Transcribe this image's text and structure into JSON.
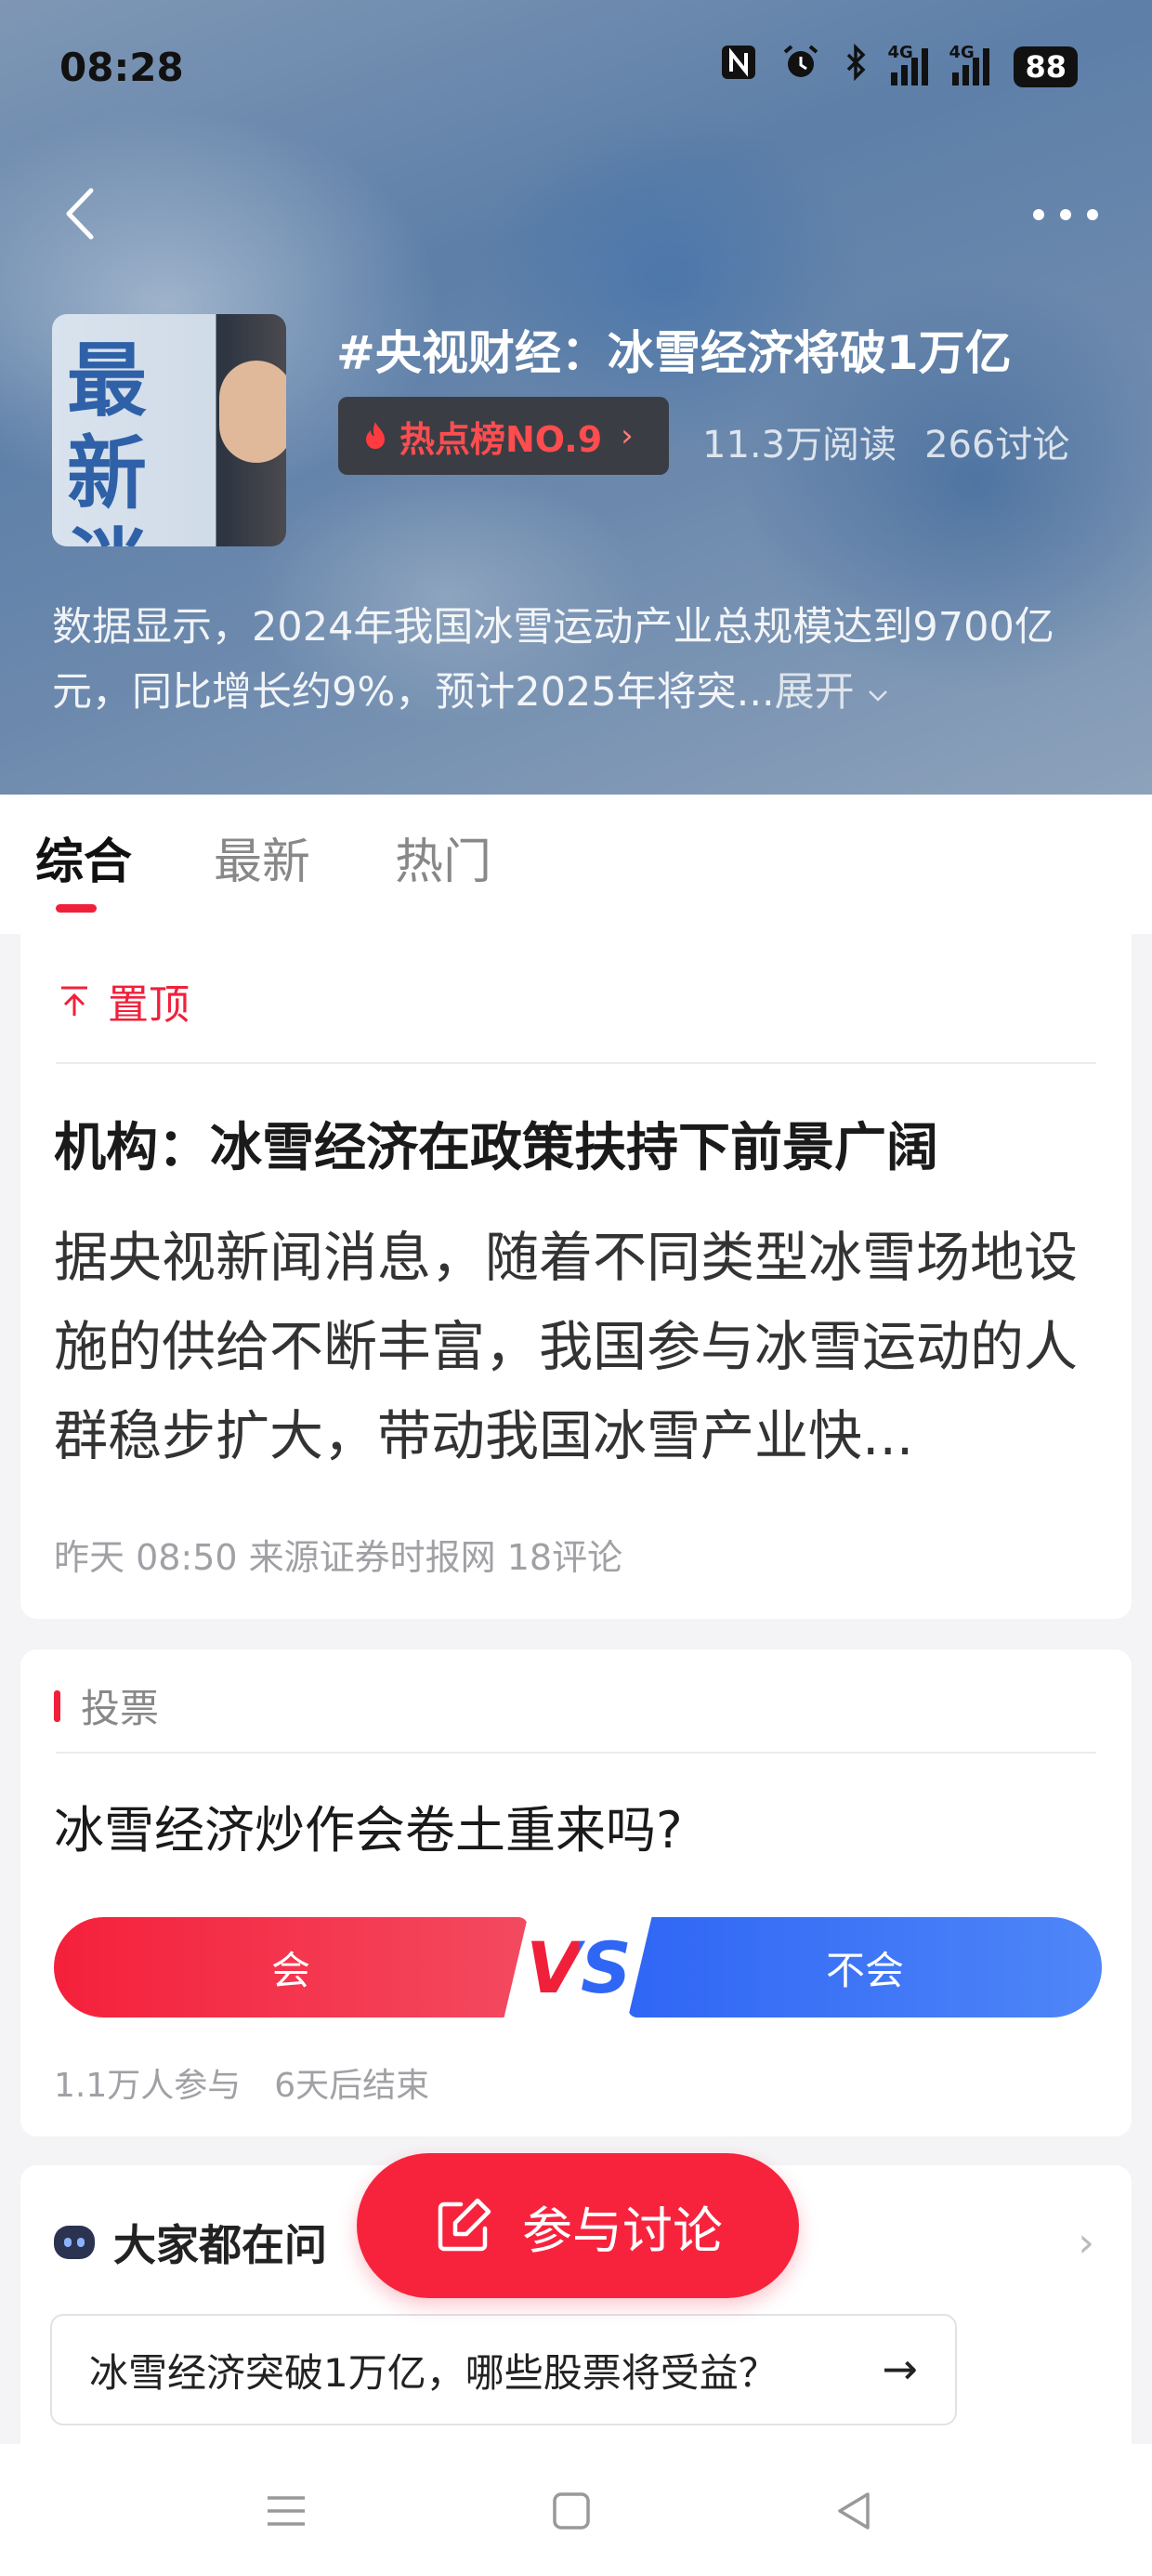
{
  "status_bar": {
    "time": "08:28",
    "icons": [
      "nfc-icon",
      "alarm-icon",
      "bluetooth-icon",
      "signal-4g-icon",
      "signal-4g-icon"
    ],
    "signal_label": "4G",
    "battery": "88"
  },
  "header": {
    "topic_title": "#央视财经：冰雪经济将破1万亿",
    "hot_rank_label": "热点榜NO.9",
    "reads": "11.3万阅读",
    "discussions": "266讨论",
    "thumbnail_text": "最新消息",
    "description": "数据显示，2024年我国冰雪运动产业总规模达到9700亿元，同比增长约9%，预计2025年将突...",
    "expand_label": "展开"
  },
  "tabs": [
    {
      "label": "综合",
      "active": true
    },
    {
      "label": "最新",
      "active": false
    },
    {
      "label": "热门",
      "active": false
    }
  ],
  "pinned_article": {
    "pin_label": "置顶",
    "title": "机构：冰雪经济在政策扶持下前景广阔",
    "excerpt": "据央视新闻消息，随着不同类型冰雪场地设施的供给不断丰富，我国参与冰雪运动的人群稳步扩大，带动我国冰雪产业快...",
    "meta": "昨天 08:50 来源证券时报网 18评论"
  },
  "vote": {
    "section_label": "投票",
    "question": "冰雪经济炒作会卷土重来吗?",
    "option_yes": "会",
    "vs_label": "VS",
    "option_no": "不会",
    "participants": "1.1万人参与",
    "deadline": "6天后结束"
  },
  "ask": {
    "heading": "大家都在问",
    "question": "冰雪经济突破1万亿，哪些股票将受益？"
  },
  "fab": {
    "label": "参与讨论"
  },
  "colors": {
    "accent_red": "#f1203a",
    "accent_blue": "#2f66f5"
  }
}
